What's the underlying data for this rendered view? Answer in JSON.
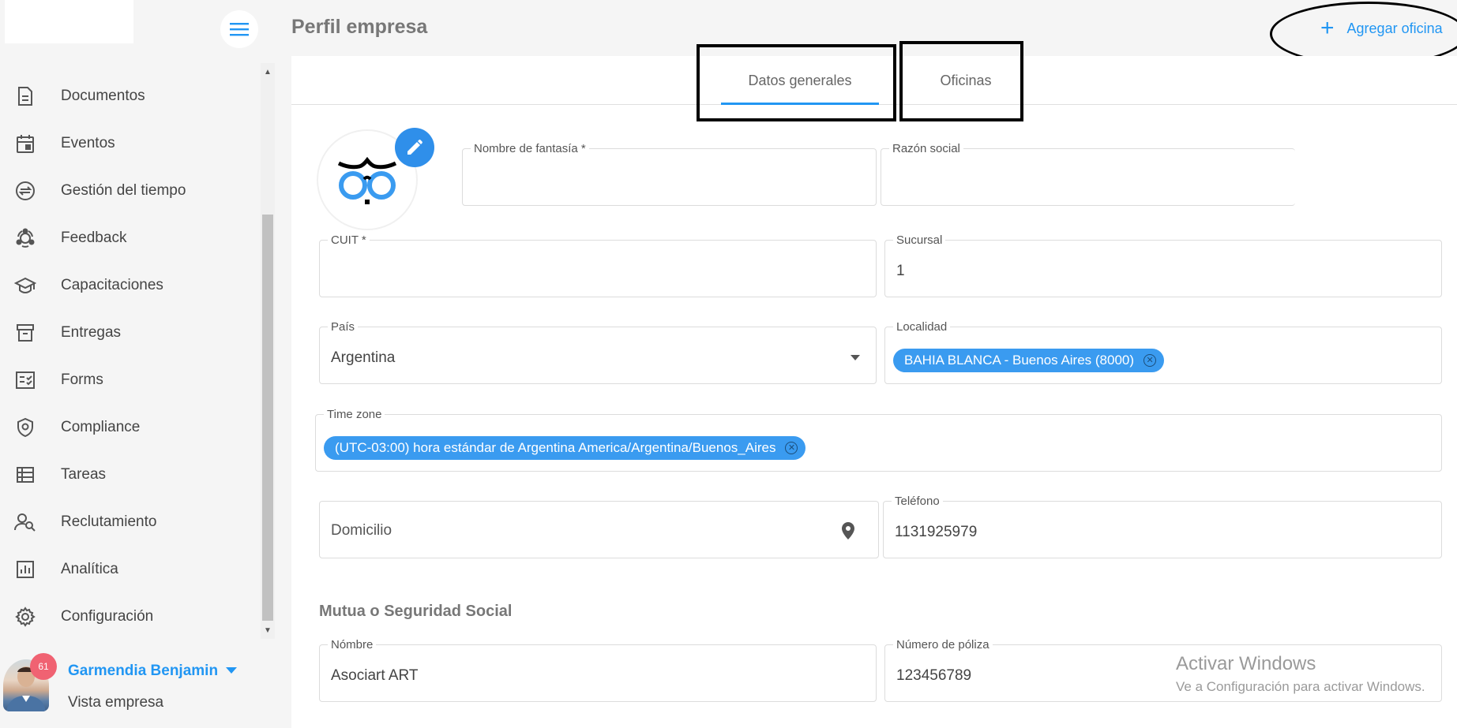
{
  "sidebar": {
    "items": [
      {
        "label": "Documentos",
        "icon": "document-icon"
      },
      {
        "label": "Eventos",
        "icon": "calendar-icon"
      },
      {
        "label": "Gestión del tiempo",
        "icon": "time-exchange-icon"
      },
      {
        "label": "Feedback",
        "icon": "feedback-icon"
      },
      {
        "label": "Capacitaciones",
        "icon": "graduation-cap-icon"
      },
      {
        "label": "Entregas",
        "icon": "archive-box-icon"
      },
      {
        "label": "Forms",
        "icon": "checklist-icon"
      },
      {
        "label": "Compliance",
        "icon": "shield-icon"
      },
      {
        "label": "Tareas",
        "icon": "task-list-icon"
      },
      {
        "label": "Reclutamiento",
        "icon": "people-search-icon"
      },
      {
        "label": "Analítica",
        "icon": "bar-chart-icon"
      },
      {
        "label": "Configuración",
        "icon": "gear-icon"
      }
    ]
  },
  "user": {
    "name": "Garmendia Benjamin",
    "badge": "61",
    "subtitle": "Vista empresa"
  },
  "header": {
    "title": "Perfil empresa",
    "add_office_label": "Agregar oficina"
  },
  "tabs": {
    "general": "Datos generales",
    "offices": "Oficinas"
  },
  "form": {
    "fantasy_name": {
      "label": "Nombre de fantasía *",
      "value": ""
    },
    "business_name": {
      "label": "Razón social",
      "value": ""
    },
    "cuit": {
      "label": "CUIT *",
      "value": ""
    },
    "branch": {
      "label": "Sucursal",
      "value": "1"
    },
    "country": {
      "label": "País",
      "value": "Argentina"
    },
    "locality": {
      "label": "Localidad",
      "chip": "BAHIA BLANCA - Buenos Aires (8000)"
    },
    "timezone": {
      "label": "Time zone",
      "chip": "(UTC-03:00) hora estándar de Argentina America/Argentina/Buenos_Aires"
    },
    "address": {
      "placeholder": "Domicilio"
    },
    "phone": {
      "label": "Teléfono",
      "value": "1131925979"
    },
    "social_section_title": "Mutua o Seguridad Social",
    "insurer_name": {
      "label": "Nómbre",
      "value": "Asociart ART"
    },
    "policy_number": {
      "label": "Número de póliza",
      "value": "123456789"
    }
  },
  "watermark": {
    "line1": "Activar Windows",
    "line2": "Ve a Configuración para activar Windows."
  },
  "colors": {
    "accent": "#2196f3",
    "chip": "#3a9bf0",
    "badge": "#f06272"
  }
}
